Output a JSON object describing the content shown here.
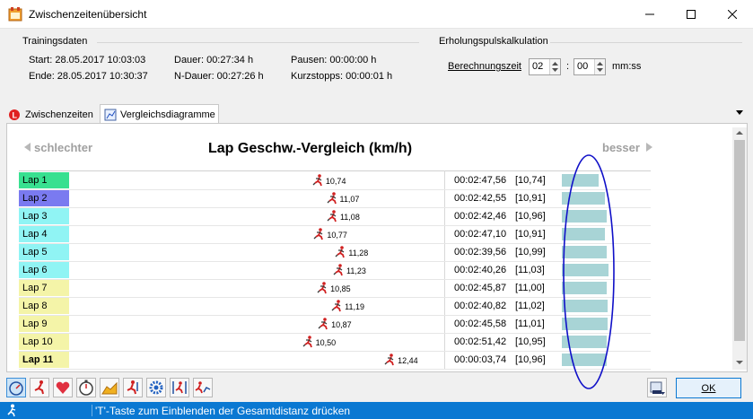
{
  "window": {
    "title": "Zwischenzeitenübersicht"
  },
  "training": {
    "group_label": "Trainingsdaten",
    "start": "Start: 28.05.2017 10:03:03",
    "end": "Ende: 28.05.2017 10:30:37",
    "dauer": "Dauer: 00:27:34 h",
    "ndauer": "N-Dauer: 00:27:26 h",
    "pausen": "Pausen: 00:00:00 h",
    "kurzstopps": "Kurzstopps: 00:00:01 h"
  },
  "recovery": {
    "group_label": "Erholungspulskalkulation",
    "field_label": "Berechnungszeit",
    "minutes": "02",
    "separator": ":",
    "seconds": "00",
    "unit": "mm:ss"
  },
  "tabs": [
    {
      "label": "Zwischenzeiten"
    },
    {
      "label": "Vergleichsdiagramme"
    }
  ],
  "diagram": {
    "worse_label": "schlechter",
    "better_label": "besser",
    "title": "Lap Geschw.-Vergleich (km/h)"
  },
  "laps": [
    {
      "label": "Lap 1",
      "color": "#38e090",
      "speed": 10.74,
      "speed_text": "10,74",
      "time": "00:02:47,56",
      "avg": "[10,74]",
      "bar": 0.58
    },
    {
      "label": "Lap 2",
      "color": "#7a7af0",
      "speed": 11.07,
      "speed_text": "11,07",
      "time": "00:02:42,55",
      "avg": "[10,91]",
      "bar": 0.68
    },
    {
      "label": "Lap 3",
      "color": "#90f4f4",
      "speed": 11.08,
      "speed_text": "11,08",
      "time": "00:02:42,46",
      "avg": "[10,96]",
      "bar": 0.71
    },
    {
      "label": "Lap 4",
      "color": "#90f4f4",
      "speed": 10.77,
      "speed_text": "10,77",
      "time": "00:02:47,10",
      "avg": "[10,91]",
      "bar": 0.68
    },
    {
      "label": "Lap 5",
      "color": "#90f4f4",
      "speed": 11.28,
      "speed_text": "11,28",
      "time": "00:02:39,56",
      "avg": "[10,99]",
      "bar": 0.72
    },
    {
      "label": "Lap 6",
      "color": "#90f4f4",
      "speed": 11.23,
      "speed_text": "11,23",
      "time": "00:02:40,26",
      "avg": "[11,03]",
      "bar": 0.74
    },
    {
      "label": "Lap 7",
      "color": "#f4f4a8",
      "speed": 10.85,
      "speed_text": "10,85",
      "time": "00:02:45,87",
      "avg": "[11,00]",
      "bar": 0.72
    },
    {
      "label": "Lap 8",
      "color": "#f4f4a8",
      "speed": 11.19,
      "speed_text": "11,19",
      "time": "00:02:40,82",
      "avg": "[11,02]",
      "bar": 0.73
    },
    {
      "label": "Lap 9",
      "color": "#f4f4a8",
      "speed": 10.87,
      "speed_text": "10,87",
      "time": "00:02:45,58",
      "avg": "[11,01]",
      "bar": 0.73
    },
    {
      "label": "Lap 10",
      "color": "#f4f4a8",
      "speed": 10.5,
      "speed_text": "10,50",
      "time": "00:02:51,42",
      "avg": "[10,95]",
      "bar": 0.71
    },
    {
      "label": "Lap 11",
      "color": "#f4f4a8",
      "speed": 12.44,
      "speed_text": "12,44",
      "time": "00:00:03,74",
      "avg": "[10,96]",
      "bar": 0.71,
      "bold": true
    }
  ],
  "toolbar": {
    "icons": [
      "speedometer-icon",
      "runner-icon",
      "heart-icon",
      "stopwatch-icon",
      "elevation-icon",
      "runner-arrow-icon",
      "gear-icon",
      "runner-range-icon",
      "runner-chart-icon"
    ],
    "ok_label": "OK"
  },
  "status": {
    "text": "'T'-Taste zum Einblenden der Gesamtdistanz drücken"
  }
}
